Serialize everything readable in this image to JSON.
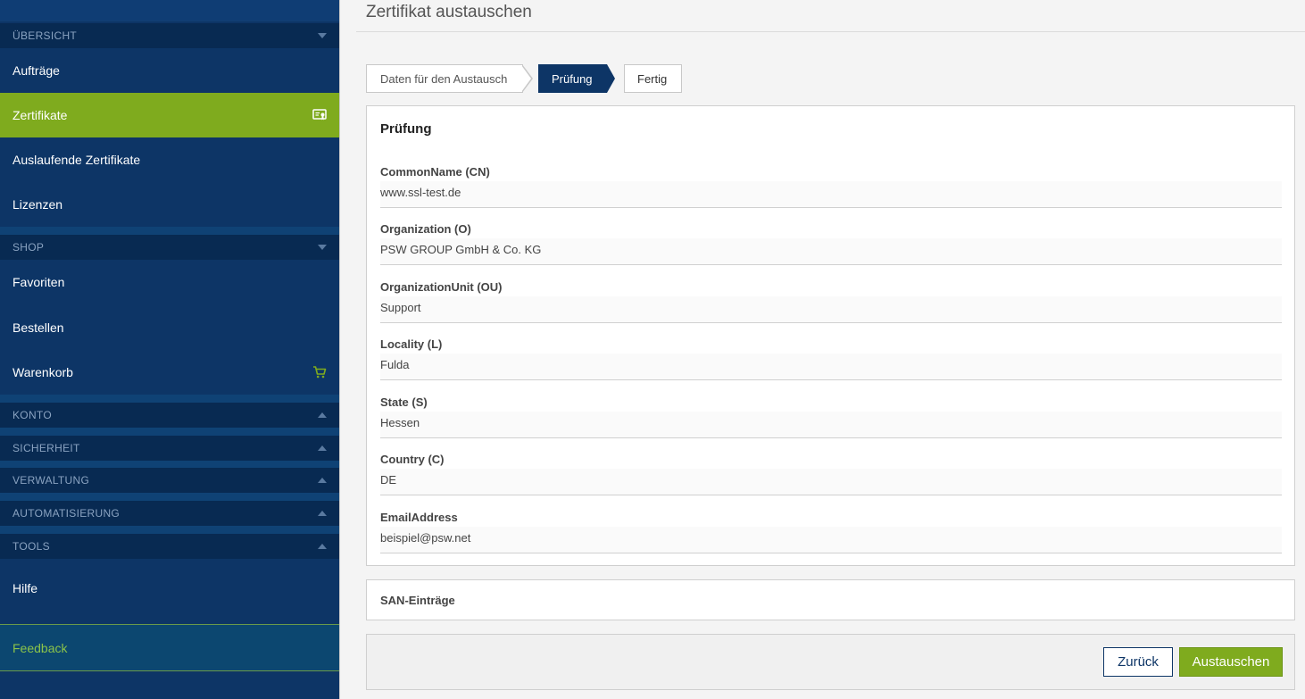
{
  "sidebar": {
    "sections": {
      "overview": "ÜBERSICHT",
      "shop": "SHOP",
      "account": "KONTO",
      "security": "SICHERHEIT",
      "admin": "VERWALTUNG",
      "automation": "AUTOMATISIERUNG",
      "tools": "TOOLS"
    },
    "items": {
      "orders": "Aufträge",
      "certificates": "Zertifikate",
      "expiring": "Auslaufende Zertifikate",
      "licenses": "Lizenzen",
      "favorites": "Favoriten",
      "order": "Bestellen",
      "cart": "Warenkorb",
      "help": "Hilfe",
      "feedback": "Feedback"
    },
    "icons": {
      "certificates": "certificate-icon",
      "cart": "cart-icon"
    },
    "colors": {
      "background": "#0d3566",
      "active": "#7fab1e",
      "section": "#082a52",
      "feedback_text": "#8bc34a"
    }
  },
  "main": {
    "title": "Zertifikat austauschen",
    "steps": {
      "data": "Daten für den Austausch",
      "check": "Prüfung",
      "done": "Fertig"
    },
    "panel": {
      "title": "Prüfung",
      "fields": [
        {
          "label": "CommonName (CN)",
          "value": "www.ssl-test.de"
        },
        {
          "label": "Organization (O)",
          "value": "PSW GROUP GmbH & Co. KG"
        },
        {
          "label": "OrganizationUnit (OU)",
          "value": "Support"
        },
        {
          "label": "Locality (L)",
          "value": "Fulda"
        },
        {
          "label": "State (S)",
          "value": "Hessen"
        },
        {
          "label": "Country (C)",
          "value": "DE"
        },
        {
          "label": "EmailAddress",
          "value": "beispiel@psw.net"
        }
      ]
    },
    "san": {
      "title": "SAN-Einträge"
    },
    "buttons": {
      "back": "Zurück",
      "exchange": "Austauschen"
    }
  }
}
